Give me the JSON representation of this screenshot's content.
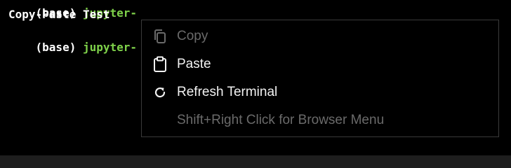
{
  "terminal": {
    "top_line": [
      {
        "text": "(base) ",
        "color": "#ffffff"
      },
      {
        "text": "jupyter-",
        "color": "#7fd24a"
      }
    ],
    "line1": "Copy-Paste Test",
    "line2_prefix": "(base) ",
    "line2_user": "jupyter-"
  },
  "context_menu": {
    "items": [
      {
        "label": "Copy",
        "icon": "copy-icon",
        "enabled": false
      },
      {
        "label": "Paste",
        "icon": "clipboard-icon",
        "enabled": true
      },
      {
        "label": "Refresh Terminal",
        "icon": "refresh-icon",
        "enabled": true
      }
    ],
    "hint": "Shift+Right Click for Browser Menu"
  },
  "colors": {
    "background": "#000000",
    "prompt_user": "#7fd24a",
    "menu_border": "#3a3a3a",
    "text_enabled": "#f2f2f2",
    "text_disabled": "#6a6a6a"
  }
}
